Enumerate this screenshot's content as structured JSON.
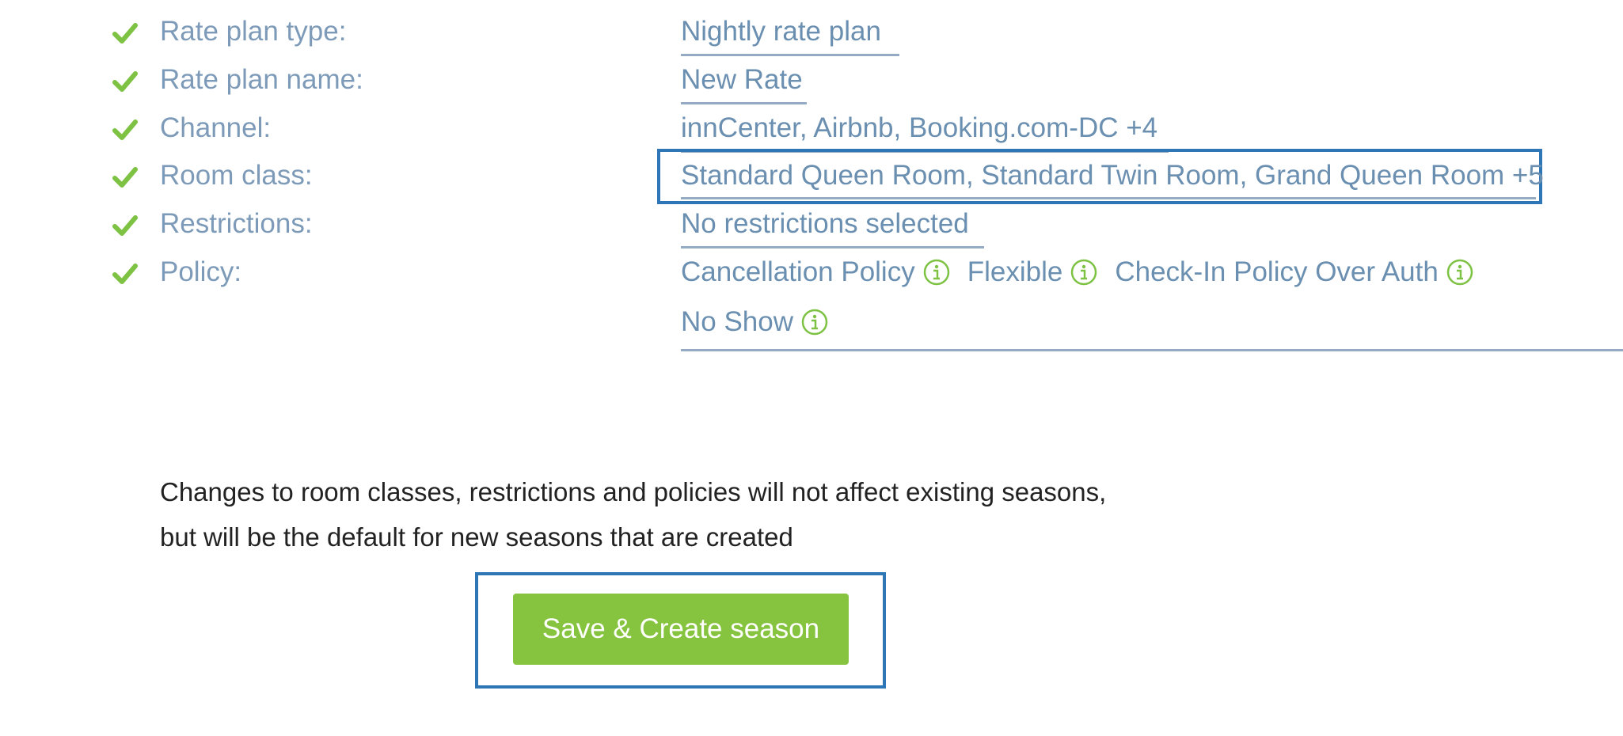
{
  "summary": {
    "rows": [
      {
        "label": "Rate plan type:",
        "value": "Nightly rate plan"
      },
      {
        "label": "Rate plan name:",
        "value": "New Rate"
      },
      {
        "label": "Channel:",
        "value": "innCenter, Airbnb, Booking.com-DC +4"
      },
      {
        "label": "Room class:",
        "value": "Standard Queen Room, Standard Twin Room, Grand Queen Room +5"
      },
      {
        "label": "Restrictions:",
        "value": "No restrictions selected"
      },
      {
        "label": "Policy:"
      }
    ],
    "policies": [
      {
        "name": "Cancellation Policy",
        "icon": "info-icon"
      },
      {
        "name": "Flexible",
        "icon": "info-icon"
      },
      {
        "name": "Check-In Policy Over Auth",
        "icon": "info-icon"
      },
      {
        "name": "No Show",
        "icon": "info-icon"
      }
    ],
    "check_icon": "check-icon"
  },
  "note": {
    "line1": "Changes to room classes, restrictions and policies will not affect existing seasons,",
    "line2": "but will be the default for new seasons that are created"
  },
  "actions": {
    "save_label": "Save & Create season"
  },
  "colors": {
    "label": "#7d9bb8",
    "link": "#6a8fb0",
    "check": "#7dc242",
    "button": "#86c440",
    "highlight": "#2f76b7"
  }
}
